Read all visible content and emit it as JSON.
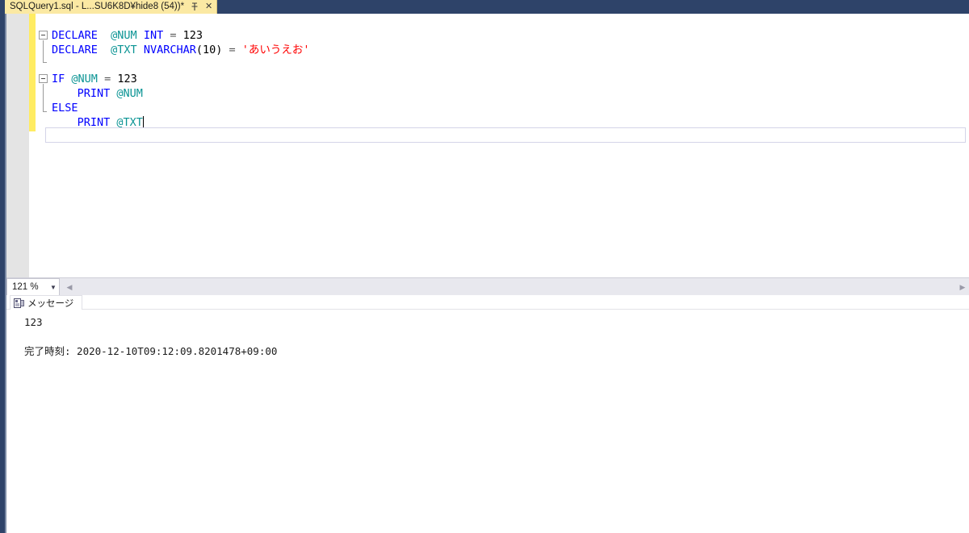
{
  "window": {
    "tab": {
      "title": "SQLQuery1.sql - L...SU6K8D¥hide8 (54))*",
      "pin_icon": "pin-icon",
      "close_label": "✕"
    }
  },
  "editor": {
    "lines": [
      {
        "indent": 0,
        "tokens": [
          {
            "t": "DECLARE",
            "c": "kw"
          },
          {
            "t": "  ",
            "c": "plain"
          },
          {
            "t": "@NUM",
            "c": "var"
          },
          {
            "t": " ",
            "c": "plain"
          },
          {
            "t": "INT",
            "c": "kw"
          },
          {
            "t": " ",
            "c": "plain"
          },
          {
            "t": "=",
            "c": "op"
          },
          {
            "t": " ",
            "c": "plain"
          },
          {
            "t": "123",
            "c": "num"
          }
        ]
      },
      {
        "indent": 0,
        "tokens": [
          {
            "t": "DECLARE",
            "c": "kw"
          },
          {
            "t": "  ",
            "c": "plain"
          },
          {
            "t": "@TXT",
            "c": "var"
          },
          {
            "t": " ",
            "c": "plain"
          },
          {
            "t": "NVARCHAR",
            "c": "kw"
          },
          {
            "t": "(10)",
            "c": "plain"
          },
          {
            "t": " ",
            "c": "plain"
          },
          {
            "t": "=",
            "c": "op"
          },
          {
            "t": " ",
            "c": "plain"
          },
          {
            "t": "'あいうえお'",
            "c": "str"
          }
        ]
      },
      {
        "indent": 0,
        "tokens": []
      },
      {
        "indent": 0,
        "tokens": [
          {
            "t": "IF",
            "c": "kw"
          },
          {
            "t": " ",
            "c": "plain"
          },
          {
            "t": "@NUM",
            "c": "var"
          },
          {
            "t": " ",
            "c": "plain"
          },
          {
            "t": "=",
            "c": "op"
          },
          {
            "t": " ",
            "c": "plain"
          },
          {
            "t": "123",
            "c": "num"
          }
        ]
      },
      {
        "indent": 4,
        "tokens": [
          {
            "t": "PRINT",
            "c": "kw"
          },
          {
            "t": " ",
            "c": "plain"
          },
          {
            "t": "@NUM",
            "c": "var"
          }
        ]
      },
      {
        "indent": 0,
        "tokens": [
          {
            "t": "ELSE",
            "c": "kw"
          }
        ]
      },
      {
        "indent": 4,
        "tokens": [
          {
            "t": "PRINT",
            "c": "kw"
          },
          {
            "t": " ",
            "c": "plain"
          },
          {
            "t": "@TXT",
            "c": "var"
          }
        ],
        "caret": true
      }
    ]
  },
  "statusbar": {
    "zoom_level": "121 %",
    "zoom_caret_icon": "chevron-down-icon",
    "scroll_left_icon": "scroll-left-arrow-icon",
    "scroll_right_icon": "scroll-right-arrow-icon"
  },
  "results": {
    "tab_label": "メッセージ",
    "tab_icon": "messages-icon",
    "output_lines": [
      "123",
      "",
      "完了時刻: 2020-12-10T09:12:09.8201478+09:00"
    ]
  },
  "colors": {
    "tab_active_bg": "#fbe9a3",
    "titlebar_bg": "#2e4369",
    "keyword": "#0000ff",
    "variable": "#0b9494",
    "string": "#ff0000",
    "change_bar": "#ffec62",
    "indicator_margin": "#e4e4e4"
  }
}
